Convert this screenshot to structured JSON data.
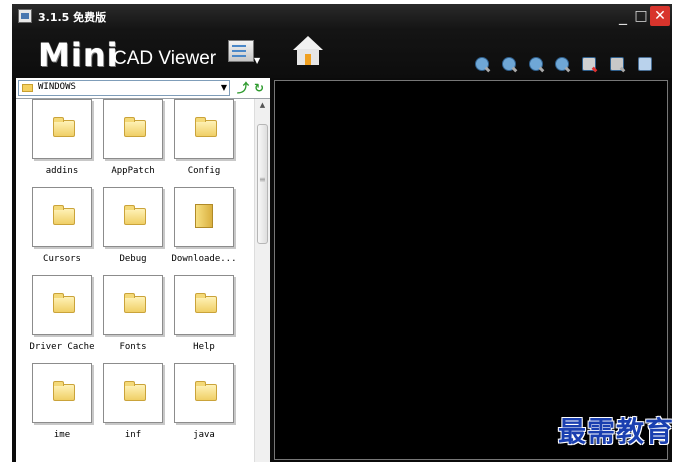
{
  "window": {
    "title": "3.1.5 免费版"
  },
  "logo": {
    "mini": "Mini",
    "cad_viewer": "CAD Viewer"
  },
  "title_buttons": {
    "minimize": "_",
    "maximize": "□",
    "close": "✕"
  },
  "toolbar": {
    "icons": [
      "document-viewer-icon",
      "home-icon",
      "zoom-in-icon",
      "zoom-out-icon",
      "zoom-window-icon",
      "zoom-fit-icon",
      "pan-icon",
      "properties-icon",
      "print-icon"
    ]
  },
  "file_panel": {
    "path": "WINDOWS",
    "files": [
      {
        "name": "addins"
      },
      {
        "name": "AppPatch"
      },
      {
        "name": "Config"
      },
      {
        "name": "Cursors"
      },
      {
        "name": "Debug"
      },
      {
        "name": "Downloade..."
      },
      {
        "name": "Driver Cache"
      },
      {
        "name": "Fonts"
      },
      {
        "name": "Help"
      },
      {
        "name": "ime"
      },
      {
        "name": "inf"
      },
      {
        "name": "java"
      }
    ]
  },
  "watermark": "最需教育",
  "colors": {
    "background": "#0b0b0b",
    "viewer": "#000000",
    "close_button": "#d8342c",
    "folder": "#f0cf66",
    "watermark": "#1a3fb0"
  }
}
